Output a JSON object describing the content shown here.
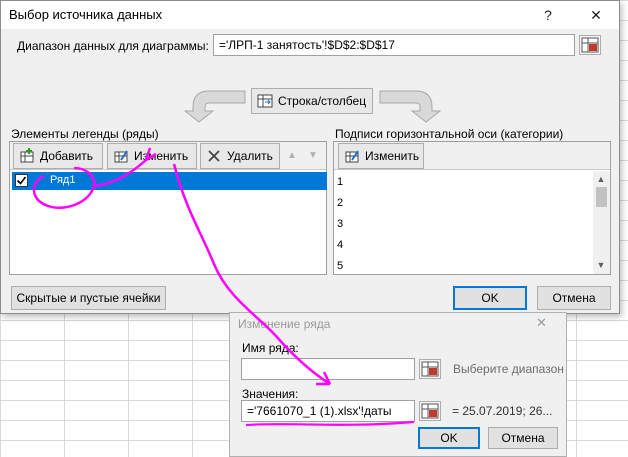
{
  "dialog": {
    "title": "Выбор источника данных",
    "help_glyph": "?",
    "close_glyph": "✕",
    "range_label": "Диапазон данных для диаграммы:",
    "range_value": "='ЛРП-1 занятость'!$D$2:$D$17",
    "switch_button": "Строка/столбец",
    "legend_header": "Элементы легенды (ряды)",
    "axis_header": "Подписи горизонтальной оси (категории)",
    "add_button": "Добавить",
    "edit_button": "Изменить",
    "delete_button": "Удалить",
    "axis_edit_button": "Изменить",
    "series": [
      {
        "label": "Ряд1",
        "checked": true
      }
    ],
    "axis_items": [
      "1",
      "2",
      "3",
      "4",
      "5"
    ],
    "hidden_cells_button": "Скрытые и пустые ячейки",
    "ok_button": "OK",
    "cancel_button": "Отмена"
  },
  "dialog2": {
    "title": "Изменение ряда",
    "close_glyph": "✕",
    "name_label": "Имя ряда:",
    "name_value": "",
    "name_hint": "Выберите диапазон",
    "values_label": "Значения:",
    "values_value": "='7661070_1 (1).xlsx'!даты",
    "values_preview": "= 25.07.2019; 26...",
    "ok_button": "OK",
    "cancel_button": "Отмена"
  },
  "colors": {
    "selection": "#0078d7",
    "annotation": "#ff00ff"
  }
}
